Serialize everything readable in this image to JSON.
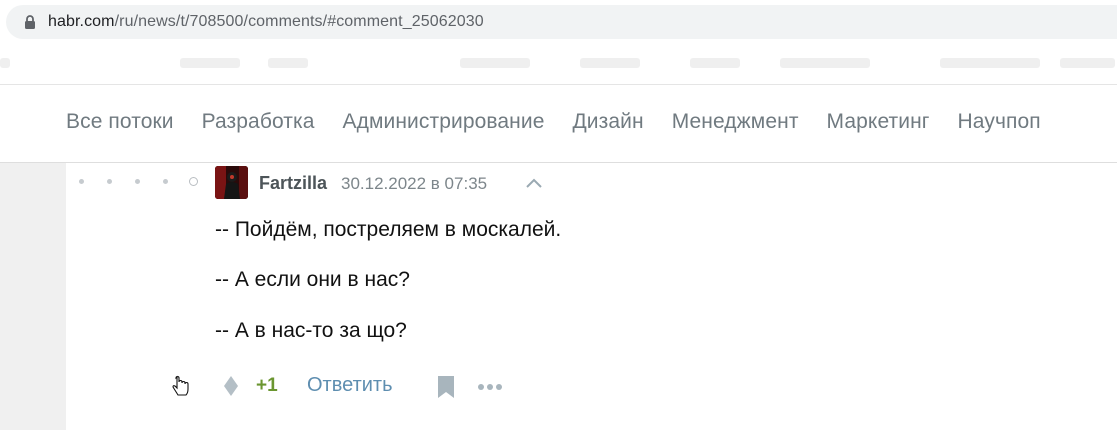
{
  "browser": {
    "url_host": "habr.com",
    "url_path": "/ru/news/t/708500/comments/#comment_25062030"
  },
  "nav": {
    "items": [
      "Все потоки",
      "Разработка",
      "Администрирование",
      "Дизайн",
      "Менеджмент",
      "Маркетинг",
      "Научпоп"
    ]
  },
  "comment": {
    "author": "Fartzilla",
    "date": "30.12.2022 в 07:35",
    "lines": [
      "-- Пойдём, постреляем в москалей.",
      "-- А если они в нас?",
      "-- А в нас-то за що?"
    ],
    "score": "+1",
    "reply_label": "Ответить"
  },
  "colors": {
    "nav_text": "#707a80",
    "score_green": "#6b9630",
    "reply_blue": "#5e8eb0"
  }
}
